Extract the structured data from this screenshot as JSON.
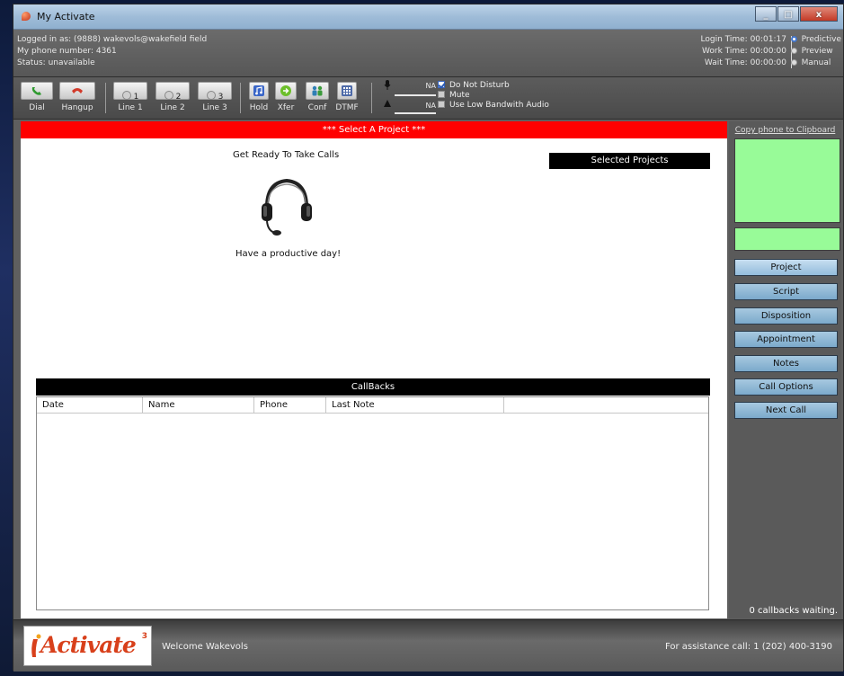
{
  "window": {
    "title": "My Activate",
    "minimize": "_",
    "maximize": "□",
    "close": "x"
  },
  "info": {
    "logged_in": "Logged in as: (9888) wakevols@wakefield field",
    "phone": "My phone number: 4361",
    "status": "Status: unavailable",
    "login_time": "Login Time: 00:01:17",
    "work_time": "Work Time: 00:00:00",
    "wait_time": "Wait Time: 00:00:00",
    "modes": [
      "Predictive",
      "Preview",
      "Manual"
    ],
    "selected_mode": "Predictive"
  },
  "toolbar": {
    "dial": "Dial",
    "hangup": "Hangup",
    "line1": "Line 1",
    "line2": "Line 2",
    "line3": "Line 3",
    "line1_num": "1",
    "line2_num": "2",
    "line3_num": "3",
    "hold": "Hold",
    "xfer": "Xfer",
    "conf": "Conf",
    "dtmf": "DTMF",
    "mic_level": "NA",
    "speaker_level": "NA",
    "do_not_disturb": "Do Not Disturb",
    "mute": "Mute",
    "low_bandwidth": "Use Low Bandwith Audio",
    "do_not_disturb_checked": true
  },
  "main": {
    "banner": "*** Select A Project ***",
    "ready": "Get Ready To Take Calls",
    "productive": "Have a productive day!",
    "selected_projects": "Selected Projects",
    "callbacks_title": "CallBacks",
    "callbacks_columns": [
      "Date",
      "Name",
      "Phone",
      "Last Note"
    ]
  },
  "right": {
    "copy_link": "Copy phone to Clipboard",
    "buttons": [
      "Project",
      "Script",
      "Disposition",
      "Appointment",
      "Notes",
      "Call Options",
      "Next Call"
    ],
    "callbacks_waiting": "0 callbacks waiting."
  },
  "footer": {
    "logo": "Activate",
    "logo_sup": "3",
    "welcome": "Welcome Wakevols",
    "assistance": "For assistance call: 1 (202) 400-3190"
  },
  "colors": {
    "banner_red": "#ff0000",
    "green_box": "#98fb98",
    "side_button": "#7ba9cb",
    "logo_orange": "#d8401b"
  }
}
